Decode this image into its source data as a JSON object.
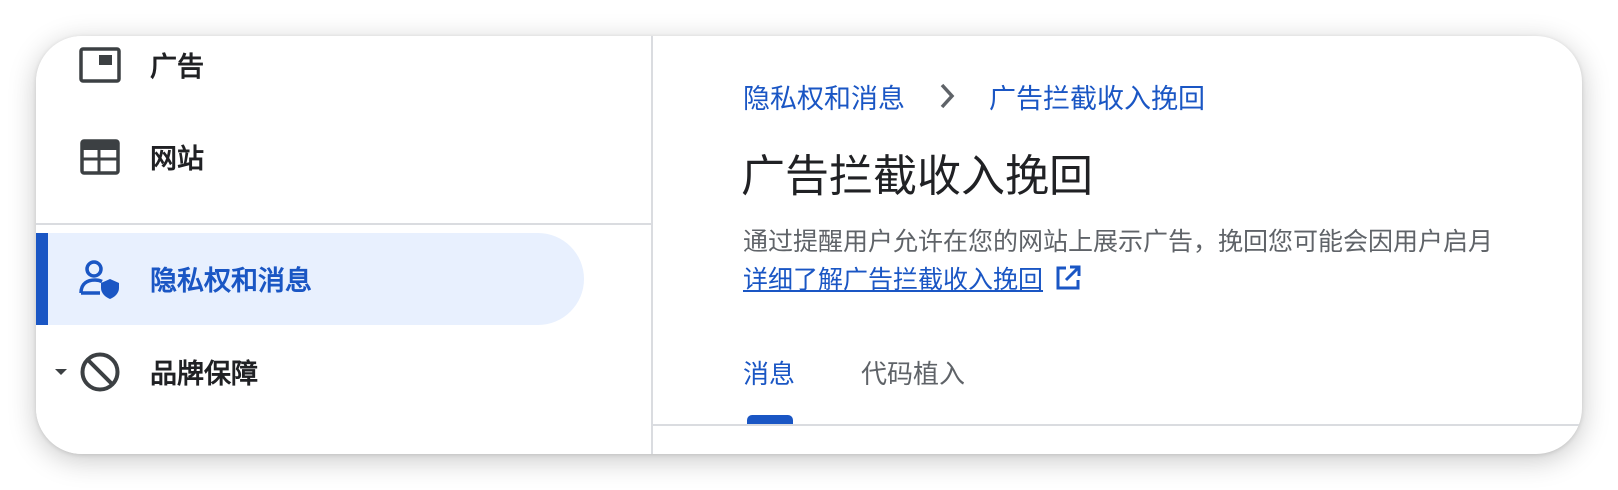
{
  "sidebar": {
    "items": [
      {
        "label": "广告",
        "icon": "ad-unit-icon"
      },
      {
        "label": "网站",
        "icon": "web-layout-icon"
      },
      {
        "label": "隐私权和消息",
        "icon": "user-shield-icon",
        "active": true
      },
      {
        "label": "品牌保障",
        "icon": "block-icon",
        "expandable": true
      }
    ]
  },
  "breadcrumb": {
    "items": [
      "隐私权和消息",
      "广告拦截收入挽回"
    ]
  },
  "page": {
    "title": "广告拦截收入挽回",
    "description": "通过提醒用户允许在您的网站上展示广告，挽回您可能会因用户启月",
    "learn_more": "详细了解广告拦截收入挽回"
  },
  "tabs": [
    {
      "label": "消息",
      "active": true
    },
    {
      "label": "代码植入",
      "active": false
    }
  ],
  "colors": {
    "accent": "#1a56c4",
    "active_bg": "#e8f0fe",
    "text_primary": "#202124",
    "text_secondary": "#5f6368",
    "divider": "#dadce0"
  }
}
